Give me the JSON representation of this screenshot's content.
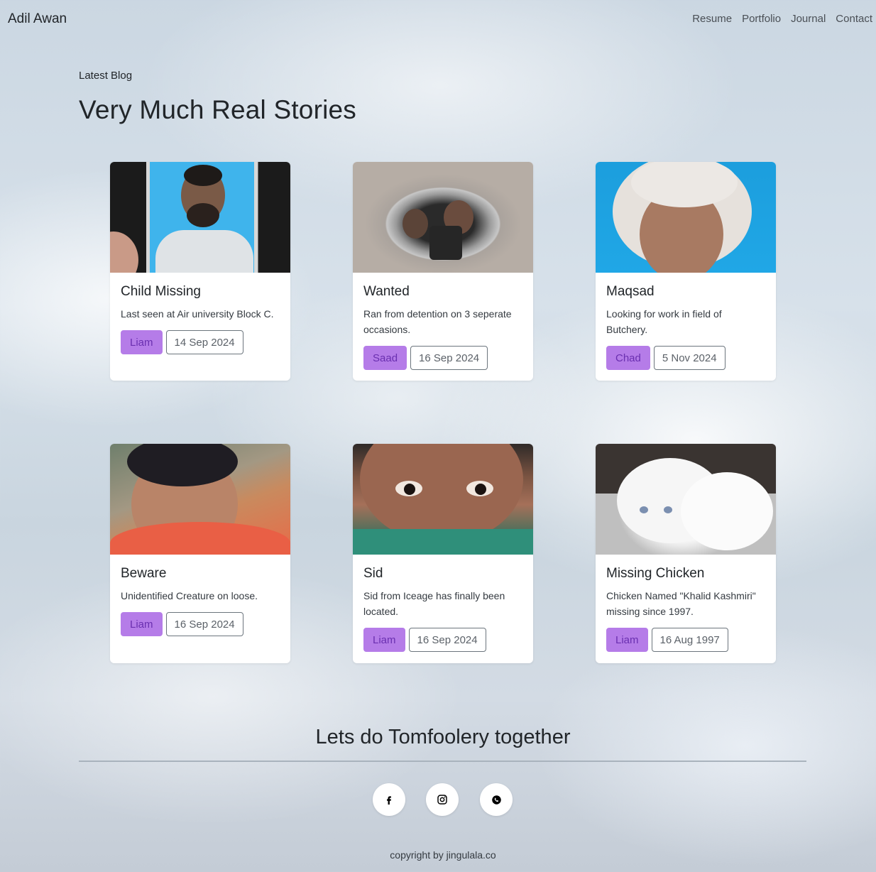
{
  "nav": {
    "brand": "Adil Awan",
    "links": [
      "Resume",
      "Portfolio",
      "Journal",
      "Contact"
    ]
  },
  "header": {
    "eyebrow": "Latest Blog",
    "title": "Very Much Real Stories"
  },
  "cards": [
    {
      "title": "Child Missing",
      "text": "Last seen at Air university Block C.",
      "author": "Liam",
      "date": "14 Sep 2024"
    },
    {
      "title": "Wanted",
      "text": "Ran from detention on 3 seperate occasions.",
      "author": "Saad",
      "date": "16 Sep 2024"
    },
    {
      "title": "Maqsad",
      "text": "Looking for work in field of Butchery.",
      "author": "Chad",
      "date": "5 Nov 2024"
    },
    {
      "title": "Beware",
      "text": "Unidentified Creature on loose.",
      "author": "Liam",
      "date": "16 Sep 2024"
    },
    {
      "title": "Sid",
      "text": "Sid from Iceage has finally been located.",
      "author": "Liam",
      "date": "16 Sep 2024"
    },
    {
      "title": "Missing Chicken",
      "text": "Chicken Named \"Khalid Kashmiri\" missing since 1997.",
      "author": "Liam",
      "date": "16 Aug 1997"
    }
  ],
  "footer": {
    "title": "Lets do Tomfoolery together",
    "social_icons": [
      "facebook-icon",
      "instagram-icon",
      "whatsapp-icon"
    ],
    "copyright": "copyright by jingulala.co"
  }
}
